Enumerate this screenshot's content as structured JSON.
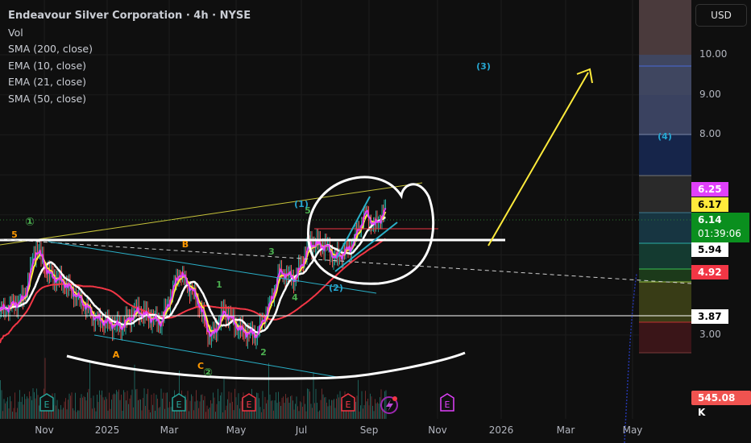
{
  "legend": {
    "title": "Endeavour Silver Corporation · 4h · NYSE",
    "indicators": [
      "Vol",
      "SMA (200, close)",
      "EMA (10, close)",
      "EMA (21, close)",
      "SMA (50, close)"
    ]
  },
  "currency_button": "USD",
  "colors": {
    "ema10": "#e040fb",
    "ema21": "#ffeb3b",
    "sma50": "#ffffff",
    "sma200": "#f23645",
    "up": "#26a69a",
    "down": "#ef5350",
    "last_price": "#0a8f1e"
  },
  "price_labels": [
    {
      "value": "6.25",
      "bg": "#e040fb",
      "fg": "#ffffff"
    },
    {
      "value": "6.17",
      "bg": "#ffeb3b",
      "fg": "#000000"
    },
    {
      "value": "6.14",
      "bg": "#0a8f1e",
      "fg": "#ffffff"
    },
    {
      "value": "5.94",
      "bg": "#ffffff",
      "fg": "#000000"
    },
    {
      "value": "4.92",
      "bg": "#f23645",
      "fg": "#ffffff"
    },
    {
      "value": "3.87",
      "bg": "#ffffff",
      "fg": "#000000"
    }
  ],
  "countdown": "01:39:06",
  "volume_label": "545.08 K",
  "chart_data": {
    "type": "line",
    "title": "Endeavour Silver Corporation · 4h · NYSE",
    "y_scale": "linear",
    "y_ticks": [
      "10.00",
      "9.00",
      "8.00",
      "3.00"
    ],
    "x_ticks": [
      "Nov",
      "2025",
      "Mar",
      "May",
      "Jul",
      "Sep",
      "Nov",
      "2026",
      "Mar",
      "May"
    ],
    "price_path": {
      "dates": [
        "2024-09-19",
        "2024-10-12",
        "2024-10-24",
        "2024-11-05",
        "2024-11-20",
        "2024-12-05",
        "2024-12-21",
        "2025-01-14",
        "2025-01-29",
        "2025-02-21",
        "2025-03-10",
        "2025-03-26",
        "2025-04-08",
        "2025-04-20",
        "2025-05-05",
        "2025-05-20",
        "2025-06-03",
        "2025-06-10",
        "2025-06-25",
        "2025-07-09",
        "2025-07-24",
        "2025-08-01",
        "2025-08-15",
        "2025-08-29",
        "2025-09-05",
        "2025-09-16"
      ],
      "close": [
        3.6,
        3.9,
        5.2,
        4.5,
        4.3,
        3.9,
        3.4,
        3.2,
        3.6,
        3.3,
        4.6,
        3.9,
        2.9,
        3.6,
        3.1,
        3.0,
        3.9,
        4.6,
        4.4,
        5.3,
        5.2,
        4.9,
        5.2,
        6.1,
        5.7,
        6.14
      ]
    },
    "last_price": 6.14,
    "horizontal_levels": [
      5.94,
      3.87
    ],
    "wave_labels": [
      {
        "text": "5",
        "color": "#ff9800"
      },
      {
        "text": "①",
        "color": "#4caf50"
      },
      {
        "text": "B",
        "color": "#ff9800"
      },
      {
        "text": "A",
        "color": "#ff9800"
      },
      {
        "text": "C",
        "color": "#ff9800"
      },
      {
        "text": "②",
        "color": "#4caf50"
      },
      {
        "text": "1",
        "color": "#4caf50"
      },
      {
        "text": "2",
        "color": "#4caf50"
      },
      {
        "text": "3",
        "color": "#4caf50"
      },
      {
        "text": "4",
        "color": "#4caf50"
      },
      {
        "text": "5",
        "color": "#4caf50"
      },
      {
        "text": "(1)",
        "color": "#26a6d1"
      },
      {
        "text": "(2)",
        "color": "#26a6d1"
      },
      {
        "text": "(3)",
        "color": "#26a6d1"
      },
      {
        "text": "(4)",
        "color": "#26a6d1"
      }
    ],
    "earnings_markers": [
      "E",
      "E",
      "E",
      "E",
      "E"
    ]
  }
}
